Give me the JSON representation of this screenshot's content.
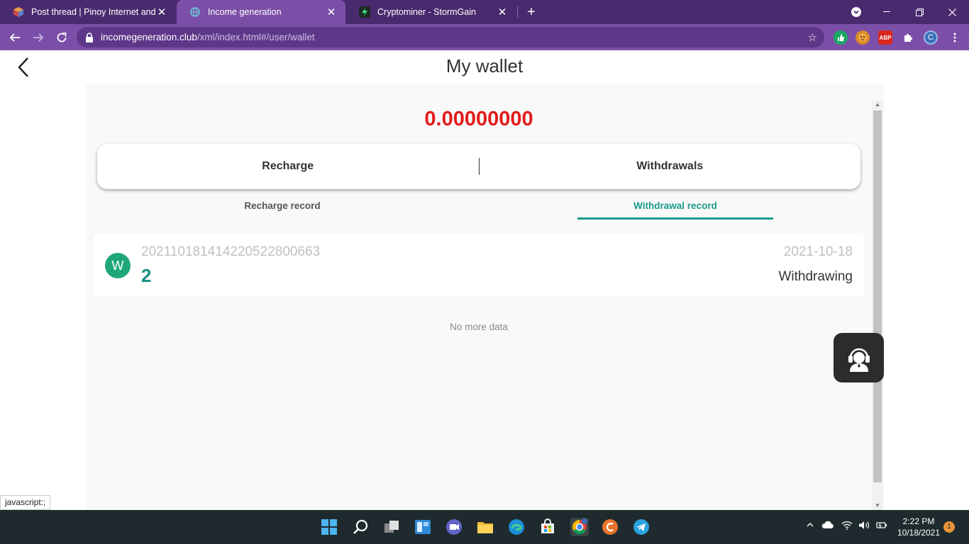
{
  "browser": {
    "tabs": [
      {
        "title": "Post thread | Pinoy Internet and T",
        "active": false
      },
      {
        "title": "Income generation",
        "active": true
      },
      {
        "title": "Cryptominer - StormGain",
        "active": false
      }
    ],
    "url_host": "incomegeneration.club",
    "url_path": "/xml/index.html#/user/wallet",
    "ext_labels": {
      "abp": "ABP",
      "profile": "C"
    },
    "accent": "#7b4fa8"
  },
  "page": {
    "title": "My wallet",
    "balance": "0.00000000",
    "actions": {
      "recharge": "Recharge",
      "withdrawals": "Withdrawals"
    },
    "record_tabs": {
      "recharge": "Recharge record",
      "withdrawal": "Withdrawal record",
      "active": "withdrawal"
    },
    "records": [
      {
        "avatar": "W",
        "id": "20211018141422052280066​3",
        "amount": "2",
        "date": "2021-10-18",
        "status": "Withdrawing"
      }
    ],
    "no_more": "No more data",
    "status_tip": "javascript:;",
    "colors": {
      "balance": "#e31b1b",
      "teal": "#1a9a8c"
    }
  },
  "taskbar": {
    "time": "2:22 PM",
    "date": "10/18/2021",
    "notifications": "1"
  }
}
